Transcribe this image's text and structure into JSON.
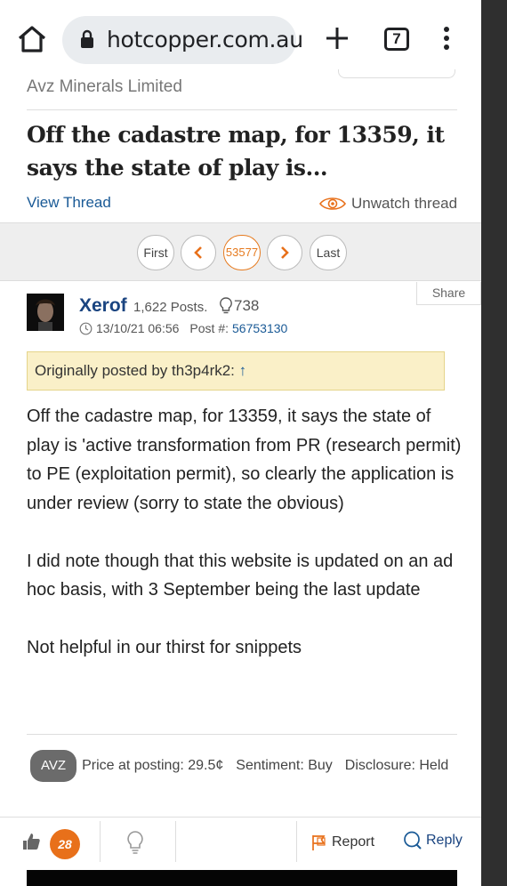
{
  "browser": {
    "url": "hotcopper.com.au",
    "tab_count": "7",
    "icons": [
      "home-icon",
      "lock-icon",
      "plus-icon",
      "tabs-icon",
      "more-vert-icon"
    ]
  },
  "thread": {
    "company": "Avz Minerals Limited",
    "title": "Off the cadastre map, for 13359, it says the state of play is...",
    "view_thread": "View Thread",
    "unwatch": "Unwatch thread"
  },
  "pager": {
    "first": "First",
    "current": "53577",
    "last": "Last"
  },
  "post": {
    "share": "Share",
    "username": "Xerof",
    "posts": "1,622 Posts.",
    "likes": "738",
    "date": "13/10/21 06:56",
    "post_label": "Post #:",
    "post_number": "56753130",
    "quote_label": "Originally posted by th3p4rk2:",
    "quote_arrow": "↑",
    "paragraphs": [
      "Off the cadastre map, for 13359, it says the state of play is 'active transformation from PR (research permit) to PE (exploitation permit), so clearly the application is under review (sorry to state the obvious)",
      "I did note though that this website is updated on an ad hoc basis, with 3 September being the last update",
      "Not helpful in our thirst for snippets"
    ],
    "ticker": "AVZ",
    "price": "Price at posting: 29.5¢",
    "sentiment": "Sentiment: Buy",
    "disclosure": "Disclosure: Held"
  },
  "actions": {
    "like_count": "28",
    "report": "Report",
    "reply": "Reply"
  },
  "colors": {
    "accent_orange": "#e8701a",
    "link_blue": "#1a5a96",
    "quote_bg": "#faf0c8"
  }
}
